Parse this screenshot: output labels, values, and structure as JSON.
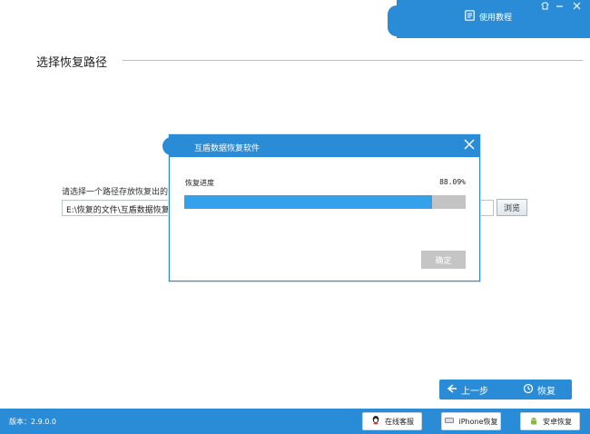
{
  "header": {
    "tutorial_label": "使用教程",
    "controls": [
      "skin-icon",
      "minimize-icon",
      "close-icon"
    ]
  },
  "main": {
    "section_title": "选择恢复路径",
    "path_label": "请选择一个路径存放恢复出的",
    "path_value": "E:\\恢复的文件\\互盾数据恢复",
    "browse_label": "浏览"
  },
  "nav": {
    "prev_label": "上一步",
    "restore_label": "恢复"
  },
  "dialog": {
    "title": "互盾数据恢复软件",
    "progress_label": "恢复进度",
    "progress_text": "88.09%",
    "progress_value": 88.09,
    "ok_label": "确定"
  },
  "statusbar": {
    "version": "版本：2.9.0.0",
    "buttons": [
      "在线客服",
      "iPhone恢复",
      "安卓恢复"
    ]
  },
  "colors": {
    "accent": "#2a8bd7",
    "progress": "#35a1ea",
    "track": "#c3c3c3",
    "disabled": "#c5c5c5"
  }
}
